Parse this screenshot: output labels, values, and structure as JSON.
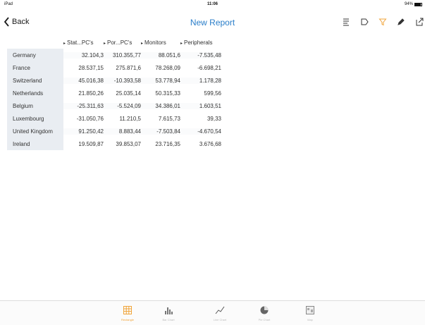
{
  "status_bar": {
    "device": "iPad",
    "time": "11:06",
    "battery": "94%",
    "battery_level": 0.94
  },
  "nav": {
    "back_label": "Back",
    "title": "New Report"
  },
  "table": {
    "columns": [
      "Stat...PC's",
      "Por...PC's",
      "Monitors",
      "Peripherals"
    ],
    "rows": [
      {
        "label": "Germany",
        "values": [
          "32.104,3",
          "310.355,77",
          "88.051,6",
          "-7.535,48"
        ]
      },
      {
        "label": "France",
        "values": [
          "28.537,15",
          "275.871,6",
          "78.268,09",
          "-6.698,21"
        ]
      },
      {
        "label": "Switzerland",
        "values": [
          "45.016,38",
          "-10.393,58",
          "53.778,94",
          "1.178,28"
        ]
      },
      {
        "label": "Netherlands",
        "values": [
          "21.850,26",
          "25.035,14",
          "50.315,33",
          "599,56"
        ]
      },
      {
        "label": "Belgium",
        "values": [
          "-25.311,63",
          "-5.524,09",
          "34.386,01",
          "1.603,51"
        ]
      },
      {
        "label": "Luxembourg",
        "values": [
          "-31.050,76",
          "11.210,5",
          "7.615,73",
          "39,33"
        ]
      },
      {
        "label": "United Kingdom",
        "values": [
          "91.250,42",
          "8.883,44",
          "-7.503,84",
          "-4.670,54"
        ]
      },
      {
        "label": "Ireland",
        "values": [
          "19.509,87",
          "39.853,07",
          "23.716,35",
          "3.676,68"
        ]
      }
    ]
  },
  "tabs": [
    {
      "label": "Rectangle",
      "icon": "grid-icon",
      "active": true
    },
    {
      "label": "Bar Chart",
      "icon": "bar-chart-icon",
      "active": false
    },
    {
      "label": "Line Chart",
      "icon": "line-chart-icon",
      "active": false
    },
    {
      "label": "Pie Chart",
      "icon": "pie-chart-icon",
      "active": false
    },
    {
      "label": "Map",
      "icon": "map-icon",
      "active": false
    }
  ],
  "colors": {
    "accent": "#2a7ec9",
    "active_tab": "#f0a43a",
    "filter_icon": "#f0a43a",
    "row_header_bg": "#e9edf2"
  }
}
